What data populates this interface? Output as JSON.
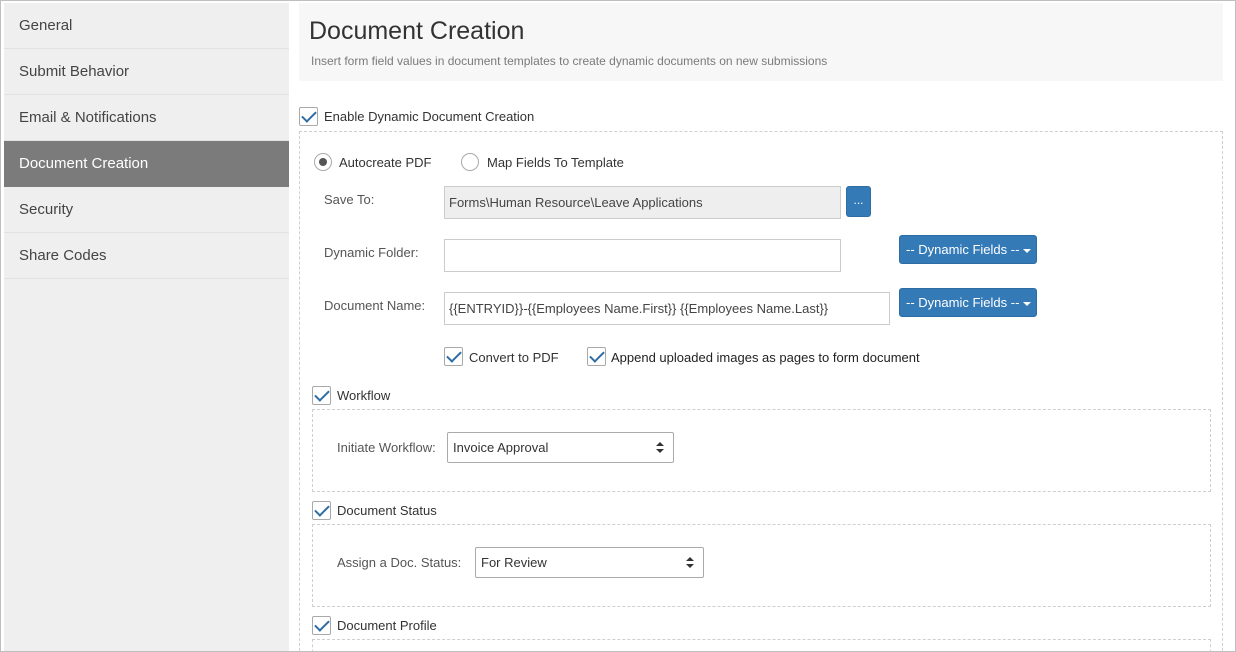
{
  "sidebar": {
    "items": [
      {
        "label": "General"
      },
      {
        "label": "Submit Behavior"
      },
      {
        "label": "Email & Notifications"
      },
      {
        "label": "Document Creation"
      },
      {
        "label": "Security"
      },
      {
        "label": "Share Codes"
      }
    ],
    "active": "Document Creation"
  },
  "header": {
    "title": "Document Creation",
    "subtitle": "Insert form field values in document templates to create dynamic documents on new submissions"
  },
  "enable": {
    "label": "Enable Dynamic Document Creation",
    "checked": true
  },
  "mode": {
    "autocreate_label": "Autocreate PDF",
    "map_label": "Map Fields To Template",
    "selected": "Autocreate PDF"
  },
  "save_to": {
    "label": "Save To:",
    "value": "Forms\\Human Resource\\Leave Applications",
    "browse_label": "..."
  },
  "dynamic_folder": {
    "label": "Dynamic Folder:",
    "value": "",
    "button_label": "-- Dynamic Fields --"
  },
  "document_name": {
    "label": "Document Name:",
    "value": "{{ENTRYID}}-{{Employees Name.First}} {{Employees Name.Last}}",
    "button_label": "-- Dynamic Fields --"
  },
  "options": {
    "convert_pdf_label": "Convert to PDF",
    "append_images_label": "Append uploaded images as pages to form document"
  },
  "workflow": {
    "label": "Workflow",
    "initiate_label": "Initiate Workflow:",
    "selected": "Invoice Approval"
  },
  "doc_status": {
    "label": "Document Status",
    "assign_label": "Assign a Doc. Status:",
    "selected": "For Review"
  },
  "doc_profile": {
    "label": "Document Profile"
  },
  "colors": {
    "primary": "#337ab7",
    "sidebar_active": "#7b7b7b",
    "sidebar_bg": "#efefef"
  }
}
